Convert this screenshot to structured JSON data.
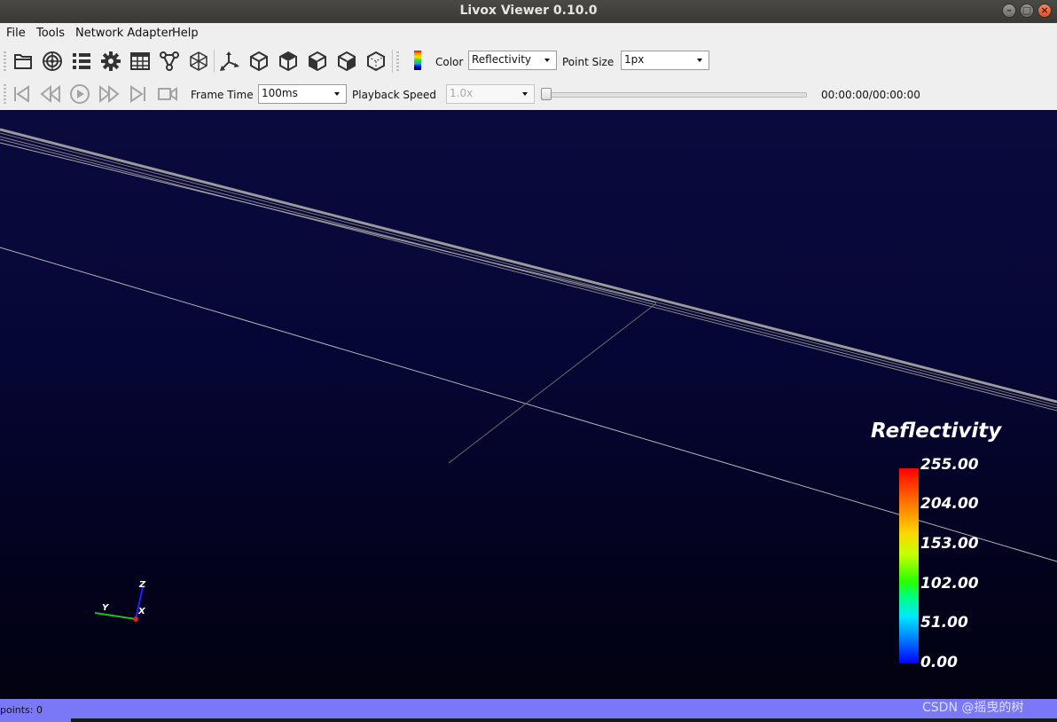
{
  "window": {
    "title": "Livox Viewer 0.10.0"
  },
  "menu": {
    "items": [
      "File",
      "Tools",
      "Network Adapter",
      "Help"
    ]
  },
  "toolbar": {
    "icons": [
      "open-folder-icon",
      "radar-icon",
      "list-icon",
      "gear-icon",
      "table-icon",
      "graph-nodes-icon",
      "wireframe-cube-icon",
      "axes-icon",
      "cube-front-icon",
      "cube-top-icon",
      "cube-left-icon",
      "cube-right-icon",
      "cube-back-icon"
    ],
    "color_label": "Color",
    "color_value": "Reflectivity",
    "point_size_label": "Point Size",
    "point_size_value": "1px"
  },
  "playback": {
    "frame_time_label": "Frame Time",
    "frame_time_value": "100ms",
    "speed_label": "Playback Speed",
    "speed_value": "1.0x",
    "progress": 0,
    "time_display": "00:00:00/00:00:00"
  },
  "legend": {
    "title": "Reflectivity",
    "ticks": [
      "255.00",
      "204.00",
      "153.00",
      "102.00",
      "51.00",
      "0.00"
    ]
  },
  "axes": {
    "z": "Z",
    "y": "Y",
    "x": "X"
  },
  "status": {
    "text": "points: 0"
  },
  "watermark": "CSDN @摇曳的树"
}
